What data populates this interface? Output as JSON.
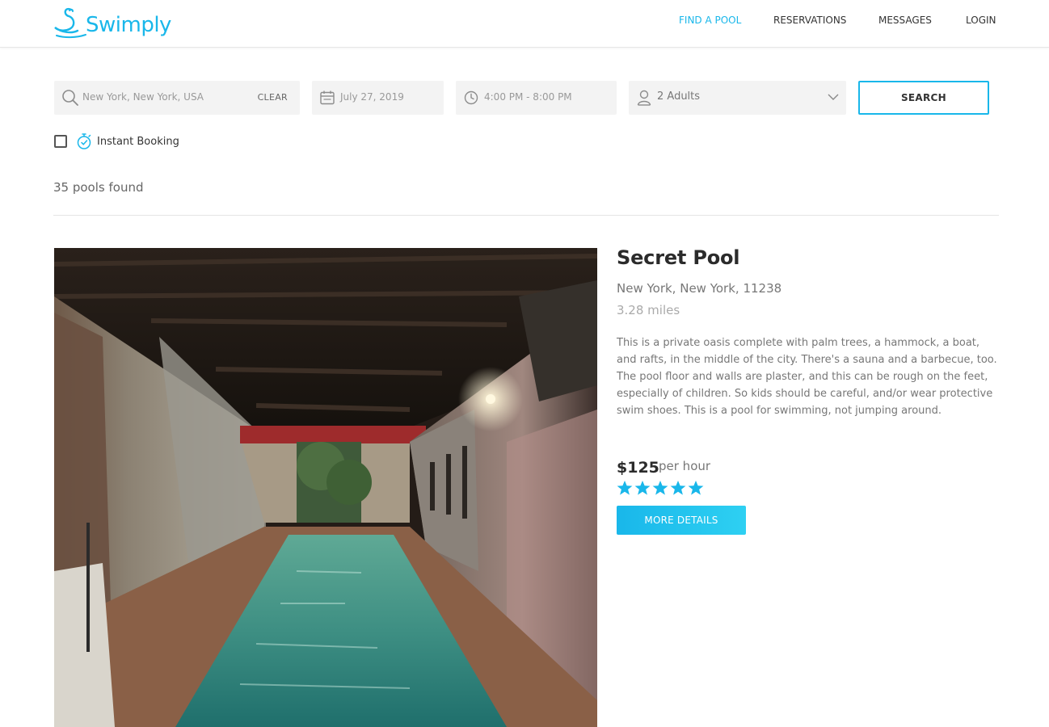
{
  "header": {
    "logo_text": "Swimply",
    "nav": {
      "find_pool": "FIND A POOL",
      "reservations": "RESERVATIONS",
      "messages": "MESSAGES",
      "login": "LOGIN"
    }
  },
  "search": {
    "location_value": "New York, New York, USA",
    "clear_label": "CLEAR",
    "date_value": "July 27, 2019",
    "time_value": "4:00 PM - 8:00 PM",
    "guests_value": "2 Adults",
    "search_label": "SEARCH",
    "icons": [
      "search-icon",
      "calendar-icon",
      "clock-icon",
      "user-icon",
      "chevron-down-icon"
    ]
  },
  "filters": {
    "instant_booking_label": "Instant Booking",
    "instant_booking_checked": false,
    "instant_booking_icon": "stopwatch-icon"
  },
  "results": {
    "count_text": "35 pools found"
  },
  "listing": {
    "title": "Secret Pool",
    "location": "New York, New York, 11238",
    "distance": "3.28 miles",
    "description": "This is a private oasis complete with palm trees, a hammock, a boat, and rafts, in the middle of the city.  There's a sauna and a barbecue, too. The pool floor and walls are plaster, and this can be rough on the feet, especially of children.  So kids should be careful, and/or wear protective swim shoes. This is a pool for swimming, not jumping around.",
    "price": "$125",
    "price_unit": "per hour",
    "rating": 5,
    "rating_max": 5,
    "more_details_label": "MORE DETAILS"
  },
  "colors": {
    "accent": "#19b7ea",
    "field_bg": "#f3f3f3",
    "text_dark": "#2b2b2b",
    "text_muted": "#777777"
  }
}
